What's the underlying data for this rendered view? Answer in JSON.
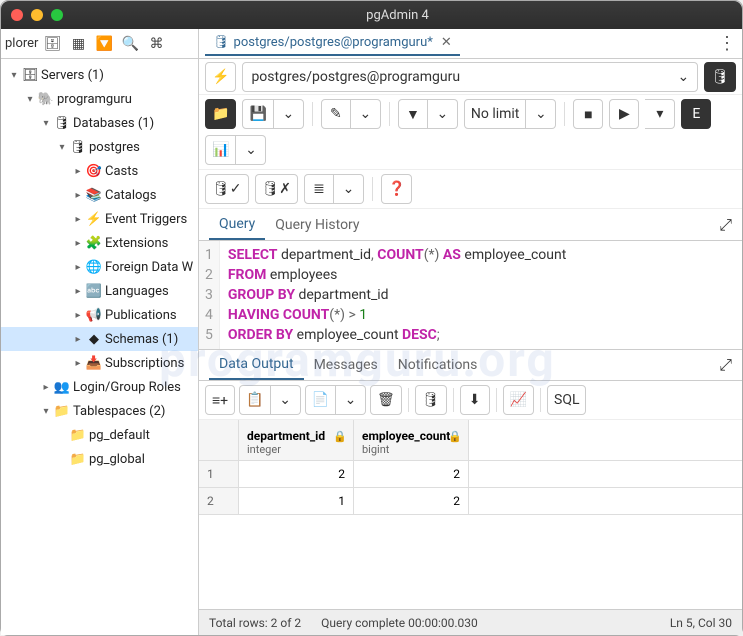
{
  "window": {
    "title": "pgAdmin 4"
  },
  "sidebar": {
    "toolbar_label": "plorer",
    "nodes": [
      {
        "d": 0,
        "tw": "▾",
        "ic": "🗄",
        "label": "Servers (1)"
      },
      {
        "d": 1,
        "tw": "▾",
        "ic": "🐘",
        "label": "programguru"
      },
      {
        "d": 2,
        "tw": "▾",
        "ic": "🛢",
        "label": "Databases (1)"
      },
      {
        "d": 3,
        "tw": "▾",
        "ic": "🛢",
        "label": "postgres"
      },
      {
        "d": 4,
        "tw": "▸",
        "ic": "🎯",
        "label": "Casts"
      },
      {
        "d": 4,
        "tw": "▸",
        "ic": "📚",
        "label": "Catalogs"
      },
      {
        "d": 4,
        "tw": "▸",
        "ic": "⚡",
        "label": "Event Triggers"
      },
      {
        "d": 4,
        "tw": "▸",
        "ic": "🧩",
        "label": "Extensions"
      },
      {
        "d": 4,
        "tw": "▸",
        "ic": "🌐",
        "label": "Foreign Data W"
      },
      {
        "d": 4,
        "tw": "▸",
        "ic": "🔤",
        "label": "Languages"
      },
      {
        "d": 4,
        "tw": "▸",
        "ic": "📢",
        "label": "Publications"
      },
      {
        "d": 4,
        "tw": "▸",
        "ic": "◆",
        "label": "Schemas (1)",
        "sel": true
      },
      {
        "d": 4,
        "tw": "▸",
        "ic": "📥",
        "label": "Subscriptions"
      },
      {
        "d": 2,
        "tw": "▸",
        "ic": "👥",
        "label": "Login/Group Roles"
      },
      {
        "d": 2,
        "tw": "▾",
        "ic": "📁",
        "label": "Tablespaces (2)"
      },
      {
        "d": 3,
        "tw": "",
        "ic": "📁",
        "label": "pg_default"
      },
      {
        "d": 3,
        "tw": "",
        "ic": "📁",
        "label": "pg_global"
      }
    ]
  },
  "tab": {
    "label": "postgres/postgres@programguru*"
  },
  "conn": {
    "text": "postgres/postgres@programguru"
  },
  "limit": "No limit",
  "qtabs": {
    "query": "Query",
    "history": "Query History"
  },
  "sql": {
    "lines": [
      "1",
      "2",
      "3",
      "4",
      "5"
    ]
  },
  "watermark": "programguru.org",
  "otabs": {
    "data": "Data Output",
    "msg": "Messages",
    "notif": "Notifications"
  },
  "sqlbtn": "SQL",
  "grid": {
    "cols": [
      {
        "name": "department_id",
        "type": "integer"
      },
      {
        "name": "employee_count",
        "type": "bigint"
      }
    ],
    "rows": [
      {
        "n": "1",
        "v": [
          "2",
          "2"
        ]
      },
      {
        "n": "2",
        "v": [
          "1",
          "2"
        ]
      }
    ]
  },
  "status": {
    "rows": "Total rows: 2 of 2",
    "time": "Query complete 00:00:00.030",
    "pos": "Ln 5, Col 30"
  },
  "chart_data": {
    "type": "table",
    "columns": [
      "department_id",
      "employee_count"
    ],
    "rows": [
      [
        2,
        2
      ],
      [
        1,
        2
      ]
    ]
  }
}
